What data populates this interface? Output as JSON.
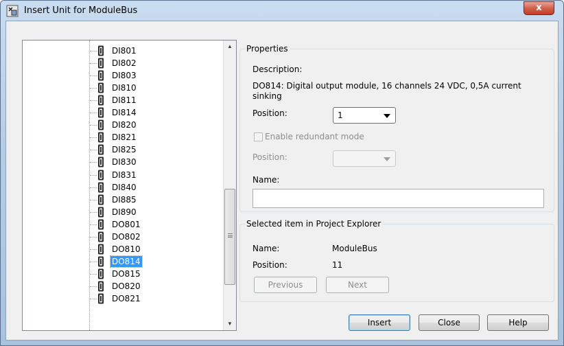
{
  "window": {
    "title": "Insert Unit for ModuleBus",
    "close_label": "x"
  },
  "tree": {
    "items": [
      {
        "label": "DI801"
      },
      {
        "label": "DI802"
      },
      {
        "label": "DI803"
      },
      {
        "label": "DI810"
      },
      {
        "label": "DI811"
      },
      {
        "label": "DI814"
      },
      {
        "label": "DI820"
      },
      {
        "label": "DI821"
      },
      {
        "label": "DI825"
      },
      {
        "label": "DI830"
      },
      {
        "label": "DI831"
      },
      {
        "label": "DI840"
      },
      {
        "label": "DI885"
      },
      {
        "label": "DI890"
      },
      {
        "label": "DO801"
      },
      {
        "label": "DO802"
      },
      {
        "label": "DO810"
      },
      {
        "label": "DO814",
        "selected": true
      },
      {
        "label": "DO815"
      },
      {
        "label": "DO820"
      },
      {
        "label": "DO821"
      }
    ],
    "scroll_up_icon": "arrow-up-icon",
    "scroll_down_icon": "arrow-down-icon"
  },
  "properties": {
    "title": "Properties",
    "description_label": "Description:",
    "description_line1": "DO814: Digital output module, 16 channels 24 VDC, 0,5A current",
    "description_line2": "sinking",
    "position_label": "Position:",
    "position_value": "1",
    "redundant_label": "Enable redundant mode",
    "redundant_position_label": "Position:",
    "redundant_position_value": "",
    "name_label": "Name:",
    "name_value": ""
  },
  "selected": {
    "title": "Selected item in Project Explorer",
    "name_label": "Name:",
    "name_value": "ModuleBus",
    "position_label": "Position:",
    "position_value": "11",
    "previous_label": "Previous",
    "next_label": "Next"
  },
  "buttons": {
    "insert": "Insert",
    "close": "Close",
    "help": "Help"
  },
  "colors": {
    "selection": "#3399ff",
    "close_button": "#c23b22"
  }
}
